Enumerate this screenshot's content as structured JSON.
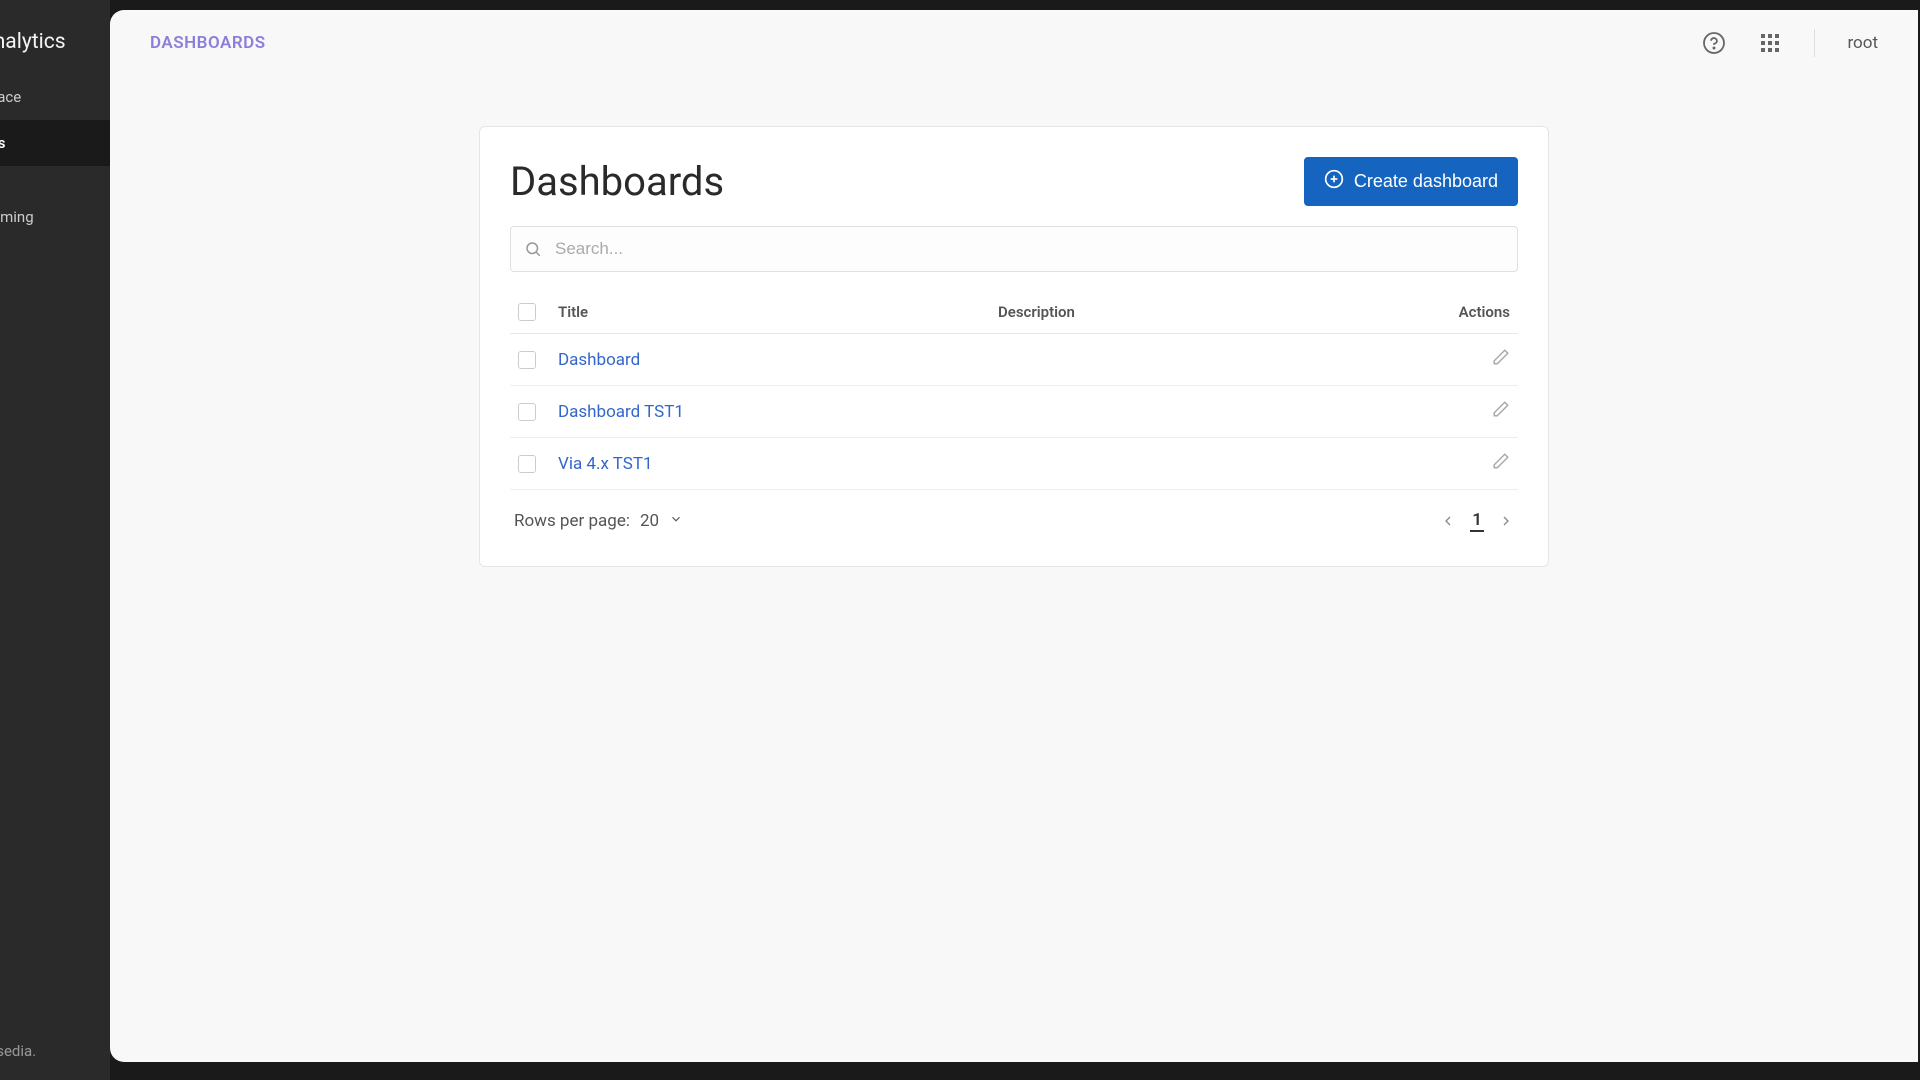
{
  "sidebar": {
    "title": "Analytics",
    "items": [
      {
        "label": "Trace",
        "active": false
      },
      {
        "label": "rds",
        "active": true
      },
      {
        "label": "",
        "active": false
      },
      {
        "label": "eaming",
        "active": false
      }
    ],
    "footer": "ensedia."
  },
  "header": {
    "breadcrumb": "DASHBOARDS",
    "user": "root"
  },
  "main": {
    "title": "Dashboards",
    "create_label": "Create dashboard",
    "search_placeholder": "Search...",
    "columns": {
      "title": "Title",
      "description": "Description",
      "actions": "Actions"
    },
    "rows": [
      {
        "title": "Dashboard",
        "description": ""
      },
      {
        "title": "Dashboard TST1",
        "description": ""
      },
      {
        "title": "Via 4.x TST1",
        "description": ""
      }
    ],
    "rows_per_page_label": "Rows per page:",
    "rows_per_page_value": "20",
    "current_page": "1"
  },
  "colors": {
    "primary": "#1565c0",
    "breadcrumb": "#8b7fd9",
    "link": "#3366cc"
  }
}
